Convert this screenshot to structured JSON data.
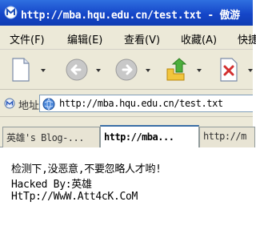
{
  "window": {
    "title": "http://mba.hqu.edu.cn/test.txt - 傲游"
  },
  "menu": {
    "items": [
      "文件(F)",
      "编辑(E)",
      "查看(V)",
      "收藏(A)",
      "快捷"
    ]
  },
  "toolbar": {
    "buttons": [
      "new-page-icon",
      "back-icon",
      "forward-icon",
      "home-icon",
      "stop-icon"
    ]
  },
  "address": {
    "label": "地址",
    "url": "http://mba.hqu.edu.cn/test.txt"
  },
  "tabs": [
    {
      "label": "英雄's Blog-...",
      "active": false
    },
    {
      "label": "http://mba...",
      "active": true
    },
    {
      "label": "http://m",
      "active": false
    }
  ],
  "page": {
    "lines": [
      "检测下,没恶意,不要忽略人才哟!",
      "Hacked By:英雄",
      "HtTp://WwW.Att4cK.CoM"
    ]
  },
  "colors": {
    "titlebar": "#1546c8",
    "chrome": "#ece9d8"
  }
}
